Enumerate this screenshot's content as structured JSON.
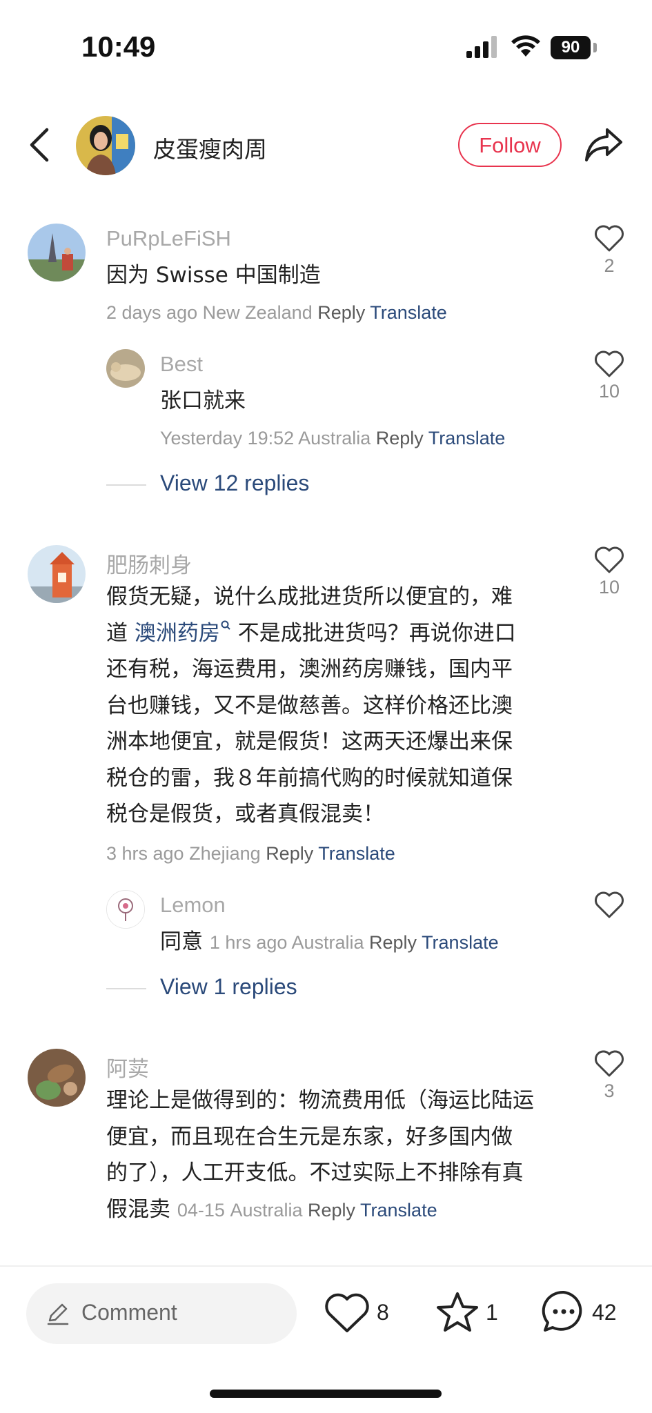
{
  "status_bar": {
    "time": "10:49",
    "battery": "90"
  },
  "header": {
    "author_name": "皮蛋瘦肉周",
    "follow_label": "Follow"
  },
  "comments": [
    {
      "username": "PuRpLeFiSH",
      "text": "因为 Swisse 中国制造",
      "time": "2 days ago",
      "location": "New Zealand",
      "reply_label": "Reply",
      "translate_label": "Translate",
      "likes": "2",
      "replies": [
        {
          "username": "Best",
          "text": "张口就来",
          "time": "Yesterday 19:52",
          "location": "Australia",
          "reply_label": "Reply",
          "translate_label": "Translate",
          "likes": "10"
        }
      ],
      "view_replies": "View 12 replies"
    },
    {
      "username": "肥肠刺身",
      "text_lines": [
        "假货无疑，说什么成批进货所以便宜的，难",
        "不是成批进货吗？再说你进口",
        "还有税，海运费用，澳洲药房赚钱，国内平",
        "台也赚钱，又不是做慈善。这样价格还比澳",
        "洲本地便宜，就是假货！这两天还爆出来保",
        "税仓的雷，我８年前搞代购的时候就知道保",
        "税仓是假货，或者真假混卖！"
      ],
      "line2_prefix": "道",
      "line2_link": "澳洲药房",
      "time": "3 hrs ago",
      "location": "Zhejiang",
      "reply_label": "Reply",
      "translate_label": "Translate",
      "likes": "10",
      "replies": [
        {
          "username": "Lemon",
          "text": "同意",
          "time": "1 hrs ago",
          "location": "Australia",
          "reply_label": "Reply",
          "translate_label": "Translate",
          "likes": ""
        }
      ],
      "view_replies": "View 1 replies"
    },
    {
      "username": "阿荬",
      "text_lines": [
        "理论上是做得到的：物流费用低（海运比陆运",
        "便宜，而且现在合生元是东家，好多国内做",
        "的了），人工开支低。不过实际上不排除有真",
        "假混卖"
      ],
      "time": "04-15",
      "location": "Australia",
      "reply_label": "Reply",
      "translate_label": "Translate",
      "likes": "3"
    }
  ],
  "bottom_bar": {
    "comment_placeholder": "Comment",
    "likes": "8",
    "favorites": "1",
    "comments": "42"
  },
  "icons": [
    "back-icon",
    "share-icon",
    "heart-icon",
    "star-icon",
    "comment-bubble-icon",
    "pencil-icon",
    "search-small-icon",
    "signal-icon",
    "wifi-icon",
    "battery-icon"
  ],
  "colors": {
    "accent": "#e8344e",
    "link": "#2b4a7a"
  }
}
